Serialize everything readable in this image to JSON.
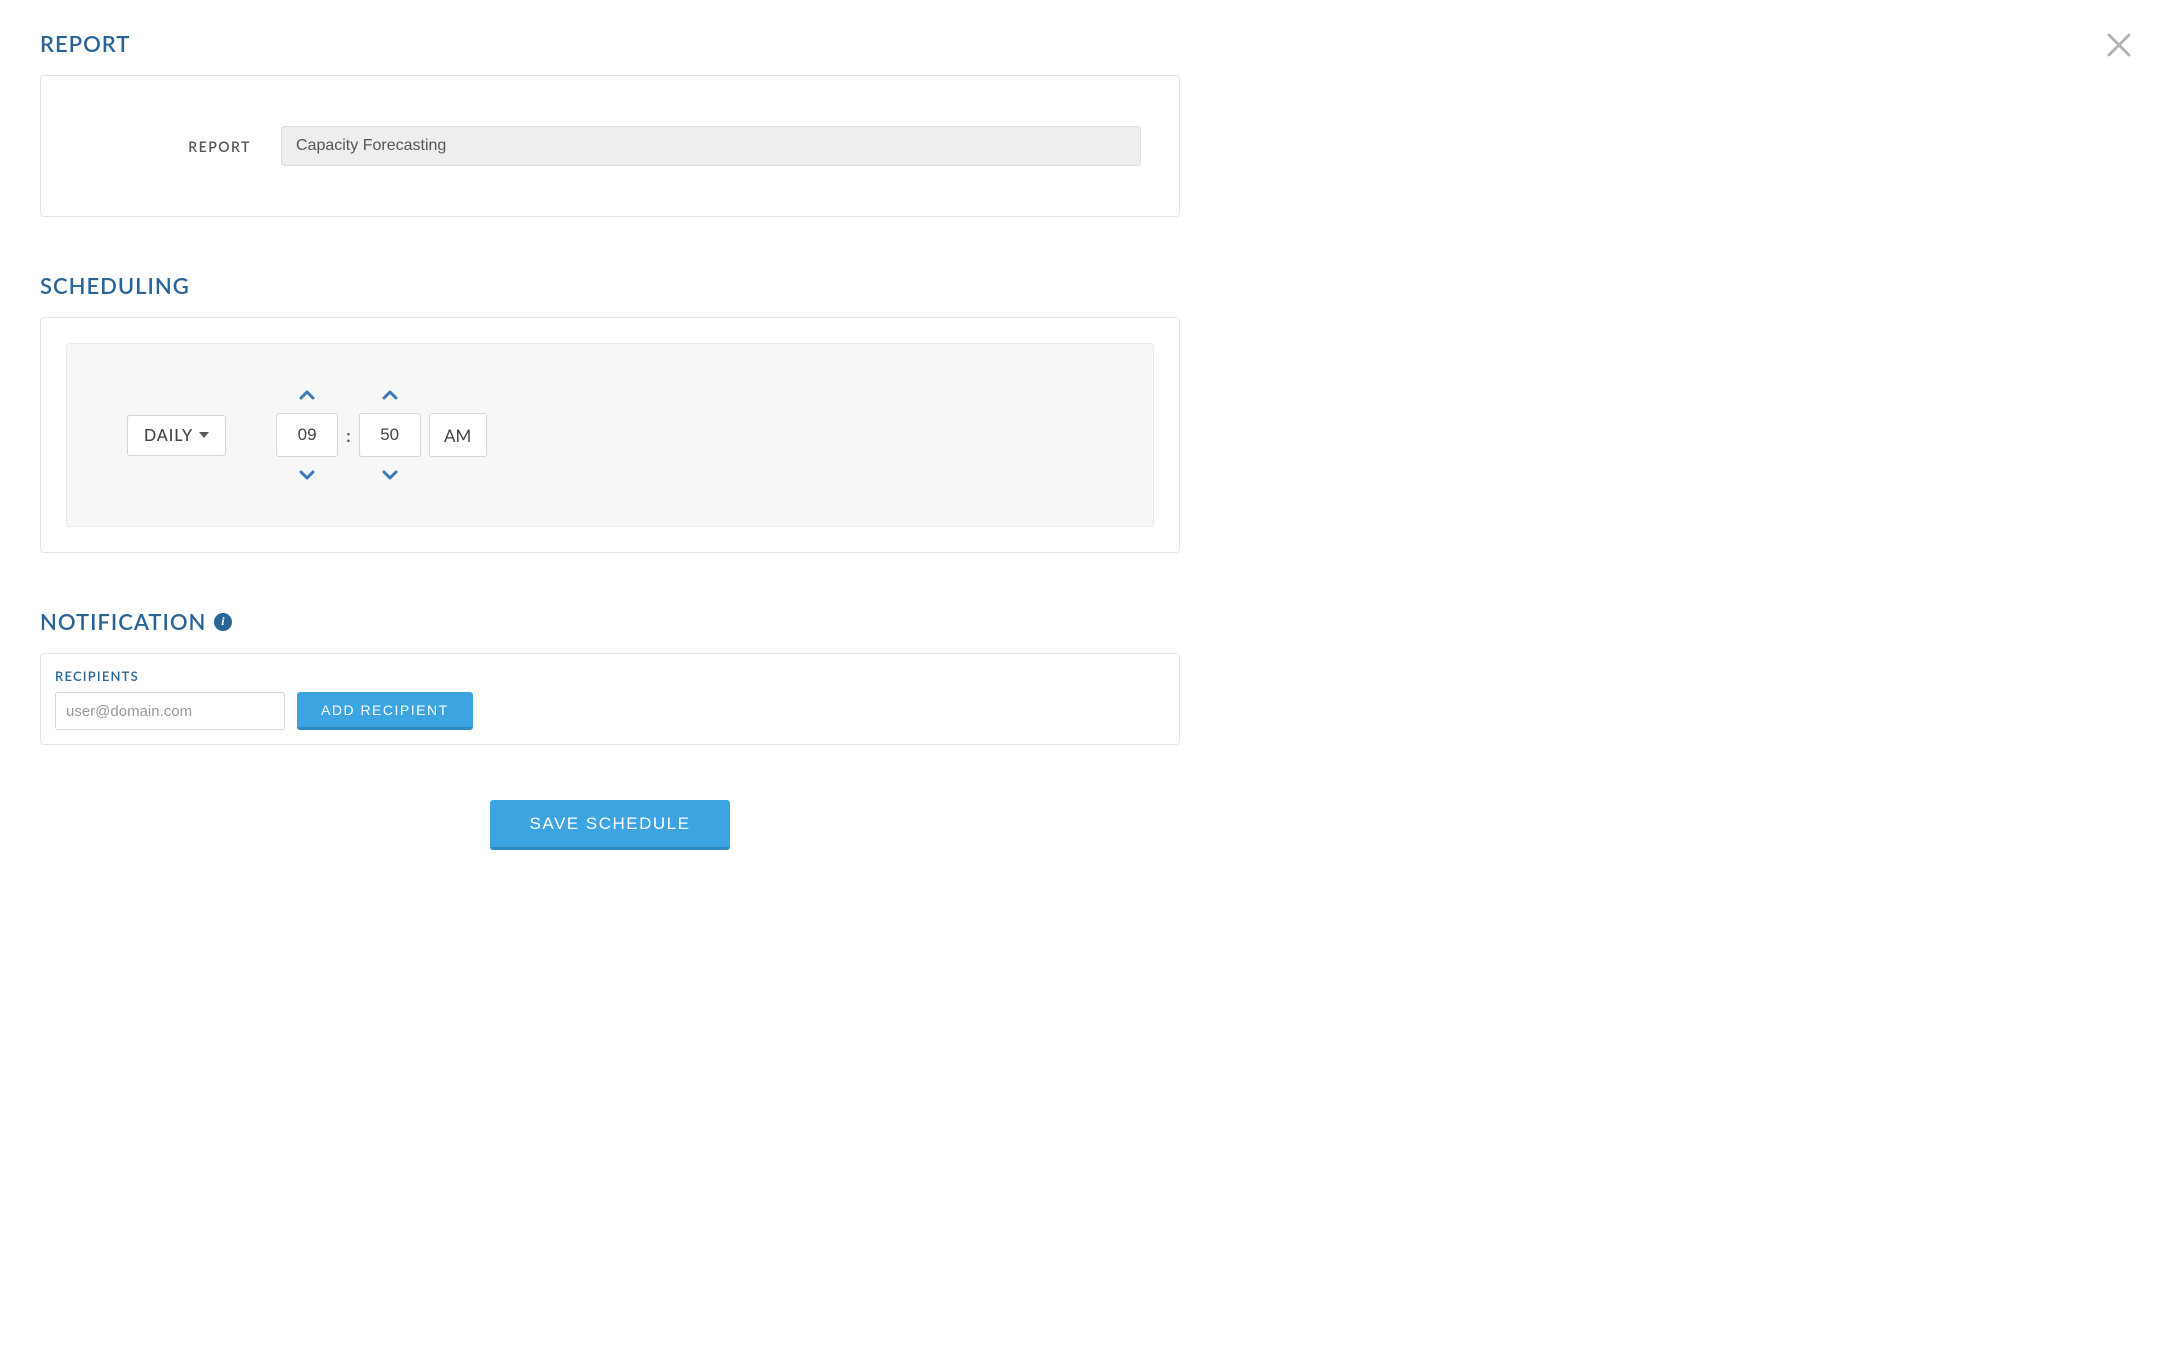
{
  "close": {
    "aria": "Close"
  },
  "report": {
    "title": "REPORT",
    "label": "REPORT",
    "value": "Capacity Forecasting"
  },
  "scheduling": {
    "title": "SCHEDULING",
    "frequency": "DAILY",
    "hour": "09",
    "minute": "50",
    "ampm": "AM"
  },
  "notification": {
    "title": "NOTIFICATION",
    "recipients_label": "RECIPIENTS",
    "placeholder": "user@domain.com",
    "value": "",
    "add_button": "ADD RECIPIENT"
  },
  "actions": {
    "save": "SAVE SCHEDULE"
  }
}
